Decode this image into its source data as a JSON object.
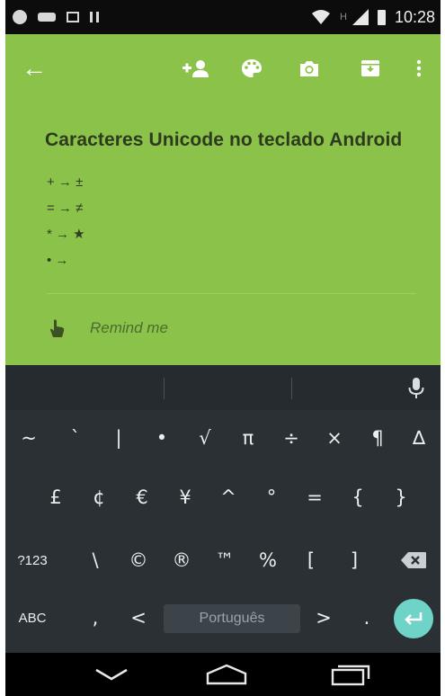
{
  "status_bar": {
    "network_indicator": "H",
    "time": "10:28"
  },
  "toolbar": {
    "back_icon": "arrow-left",
    "icons": [
      "add-person-icon",
      "palette-icon",
      "camera-icon",
      "archive-icon",
      "more-vert-icon"
    ]
  },
  "note": {
    "title": "Caracteres Unicode no teclado Android",
    "lines": [
      "+ → ±",
      "= → ≠",
      "* → ★",
      "• →"
    ],
    "remind_label": "Remind me",
    "background_color": "#8bc34a"
  },
  "keyboard": {
    "row1": [
      "~",
      "`",
      "|",
      "•",
      "√",
      "π",
      "÷",
      "×",
      "¶",
      "∆"
    ],
    "row2": [
      "£",
      "¢",
      "€",
      "¥",
      "^",
      "°",
      "=",
      "{",
      "}"
    ],
    "row3": [
      "?123",
      "\\",
      "©",
      "®",
      "™",
      "%",
      "[",
      "]"
    ],
    "row4": {
      "abc": "ABC",
      "comma": ",",
      "less_than": "<",
      "space_label": "Português",
      "greater_than": ">",
      "period": "."
    },
    "enter_color": "#6fd3c8"
  },
  "nav_bar": {
    "icons": [
      "back-chevron-icon",
      "home-icon",
      "recents-icon"
    ]
  }
}
